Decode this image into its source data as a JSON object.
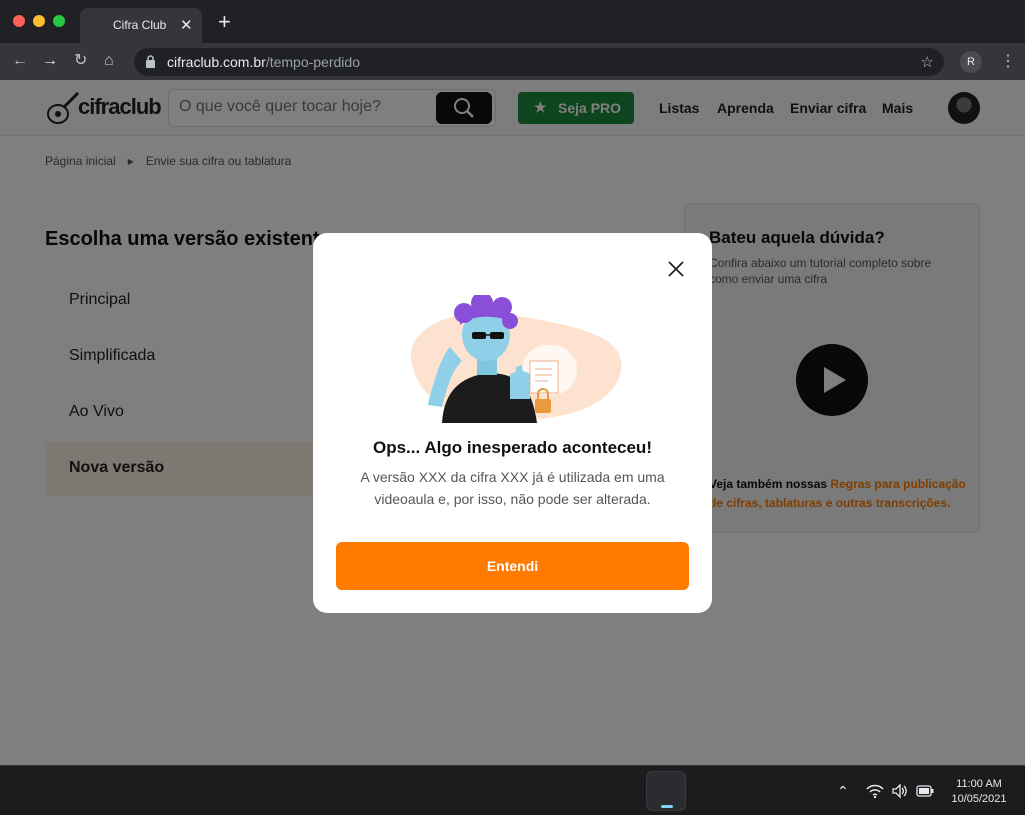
{
  "browser": {
    "tab_title": "Cifra Club",
    "tab_close": "✕",
    "new_tab": "+",
    "url_domain": "cifraclub.com.br",
    "url_path": "/tempo-perdido",
    "profile_initial": "R"
  },
  "header": {
    "logo_text": "cifraclub",
    "search_placeholder": "O que você quer tocar hoje?",
    "pro_label": "Seja PRO",
    "nav": [
      "Listas",
      "Aprenda",
      "Enviar cifra",
      "Mais"
    ]
  },
  "breadcrumb": [
    "Página inicial",
    "Envie sua cifra ou tablatura"
  ],
  "main": {
    "title": "Escolha uma versão existente",
    "versions": [
      "Principal",
      "Simplificada",
      "Ao Vivo",
      "Nova versão"
    ]
  },
  "help": {
    "title": "Bateu aquela dúvida?",
    "subtitle": "Confira abaixo um tutorial completo sobre como enviar uma cifra",
    "footer_prefix": "Veja também nossas ",
    "footer_link": "Regras para publicação de cifras, tablaturas e outras transcrições."
  },
  "modal": {
    "title": "Ops... Algo inesperado aconteceu!",
    "body": "A versão XXX da cifra XXX já é utilizada em uma videoaula e, por isso, não pode ser alterada.",
    "button": "Entendi"
  },
  "taskbar": {
    "time": "11:00 AM",
    "date": "10/05/2021"
  },
  "colors": {
    "accent": "#ff7a00",
    "pro_green": "#1e8a3c"
  }
}
